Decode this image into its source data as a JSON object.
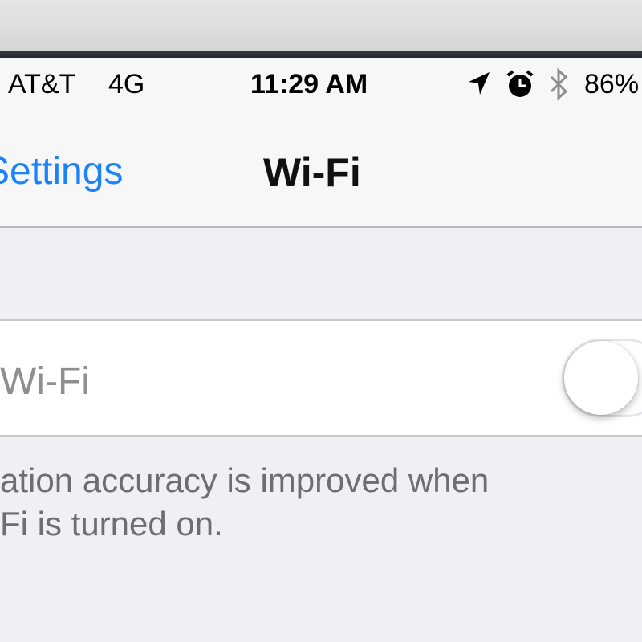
{
  "status_bar": {
    "carrier": "AT&T",
    "network": "4G",
    "time": "11:29 AM",
    "battery": "86%",
    "icons": [
      "location-arrow-icon",
      "alarm-clock-icon",
      "bluetooth-icon"
    ]
  },
  "nav": {
    "back_label": "Settings",
    "title": "Wi-Fi"
  },
  "wifi_row": {
    "label": "Wi-Fi",
    "toggle_state": "off"
  },
  "footer": {
    "line1": "ation accuracy is improved when",
    "line2": "Fi is turned on."
  },
  "colors": {
    "accent": "#1a82fb",
    "background": "#efeff4",
    "disabled_text": "#8e8e93",
    "footer_text": "#6d6d72"
  }
}
